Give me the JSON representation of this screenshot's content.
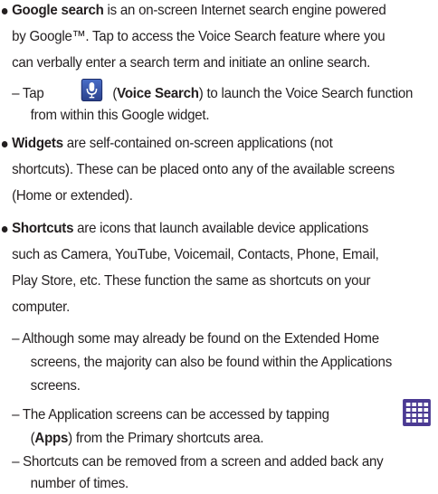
{
  "items": [
    {
      "bold": "Google search",
      "lines": [
        " is an on-screen Internet search engine powered",
        "by Google™. Tap to access the Voice Search feature where you",
        "can verbally enter a search term and initiate an online search."
      ]
    },
    {
      "sub": [
        {
          "prefix": "– Tap",
          "open": "(",
          "bold": "Voice Search",
          "rest": ") to launch the Voice Search function",
          "line2": "from within this Google widget."
        }
      ]
    },
    {
      "bold": "Widgets",
      "lines": [
        " are self-contained on-screen applications (not",
        "shortcuts). These can be placed onto any of the available screens",
        "(Home or extended)."
      ]
    },
    {
      "bold": "Shortcuts",
      "lines": [
        " are icons that launch available device applications",
        "such as Camera, YouTube, Voicemail, Contacts, Phone, Email,",
        "Play Store, etc. These function the same as shortcuts on your",
        "computer."
      ]
    },
    {
      "subs": [
        {
          "lines": [
            "– Although some may already be found on the Extended Home",
            "screens, the majority can also be found within the Applications",
            "screens."
          ]
        },
        {
          "line1": "– The Application screens can be accessed by tapping",
          "open": "(",
          "bold": "Apps",
          "rest": ") from the Primary shortcuts area."
        },
        {
          "lines": [
            "– Shortcuts can be removed from a screen and added back any",
            "number of times."
          ]
        }
      ]
    }
  ],
  "icons": {
    "voice_search": "microphone-icon",
    "apps": "apps-grid-icon"
  },
  "colors": {
    "text": "#231f20",
    "mic_blue": "#3a56b0",
    "apps_purple": "#4b3a93"
  }
}
